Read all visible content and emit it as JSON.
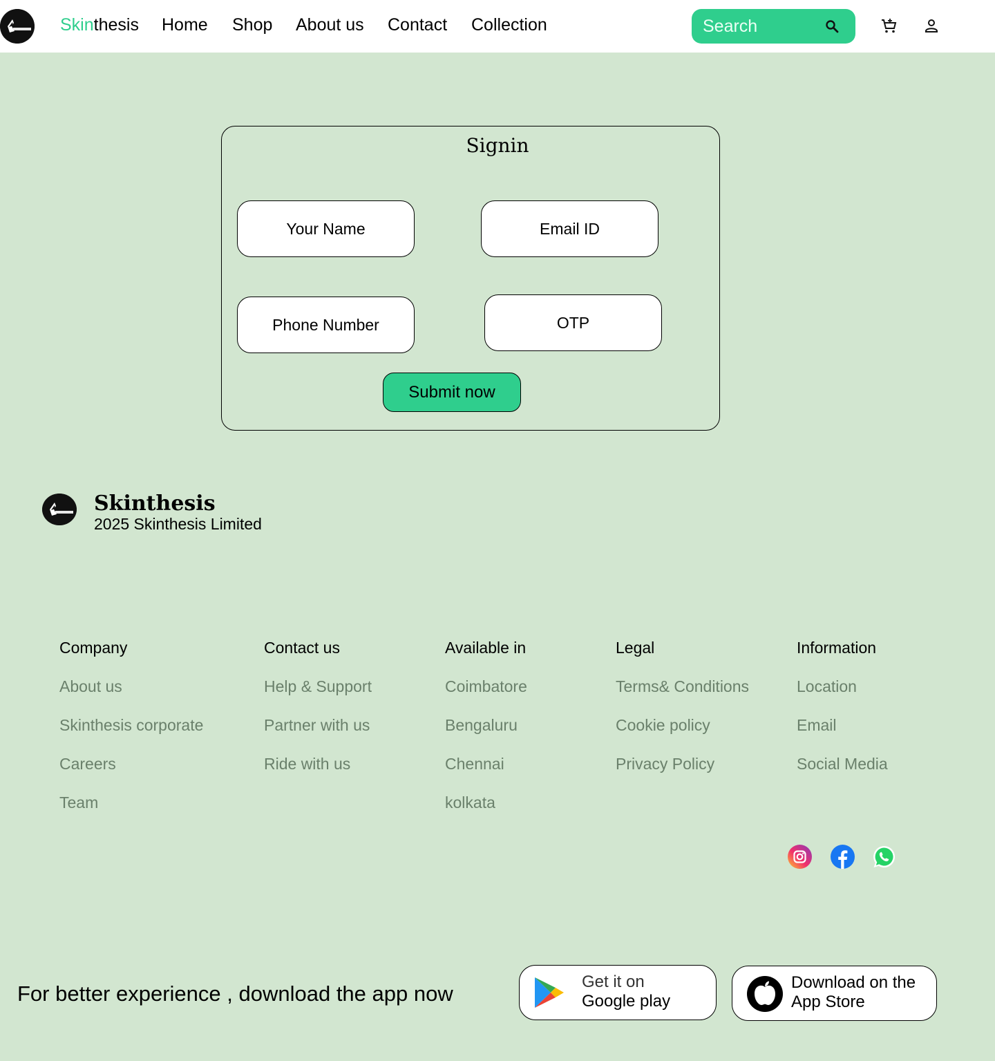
{
  "colors": {
    "accent": "#2fce8d",
    "background": "#d2e6d0",
    "muted_link": "#6a806b"
  },
  "header": {
    "brand_accent": "Skin",
    "brand_rest": "thesis",
    "nav": [
      "Home",
      "Shop",
      "About us",
      "Contact",
      "Collection"
    ],
    "search_placeholder": "Search",
    "icons": [
      "logo",
      "search-icon",
      "cart-icon",
      "user-icon"
    ]
  },
  "signin": {
    "title": "Signin",
    "name_placeholder": "Your Name",
    "email_placeholder": "Email ID",
    "phone_placeholder": "Phone Number",
    "otp_placeholder": "OTP",
    "submit_label": "Submit now"
  },
  "footer": {
    "brand": "Skinthesis",
    "copyright": "2025 Skinthesis Limited",
    "columns": [
      {
        "heading": "Company",
        "links": [
          "About us",
          "Skinthesis corporate",
          "Careers",
          "Team"
        ]
      },
      {
        "heading": "Contact us",
        "links": [
          "Help & Support",
          "Partner with us",
          "Ride with us"
        ]
      },
      {
        "heading": "Available in",
        "links": [
          "Coimbatore",
          "Bengaluru",
          "Chennai",
          "kolkata"
        ]
      },
      {
        "heading": "Legal",
        "links": [
          "Terms& Conditions",
          "Cookie policy",
          "Privacy Policy"
        ]
      },
      {
        "heading": "Information",
        "links": [
          "Location",
          "Email",
          "Social Media"
        ]
      }
    ],
    "social": [
      "instagram-icon",
      "facebook-icon",
      "whatsapp-icon"
    ]
  },
  "app_promo": {
    "text": "For better experience , download the app now",
    "google_line1": "Get it on",
    "google_line2": "Google play",
    "apple_line1": "Download on the",
    "apple_line2": "App Store"
  }
}
